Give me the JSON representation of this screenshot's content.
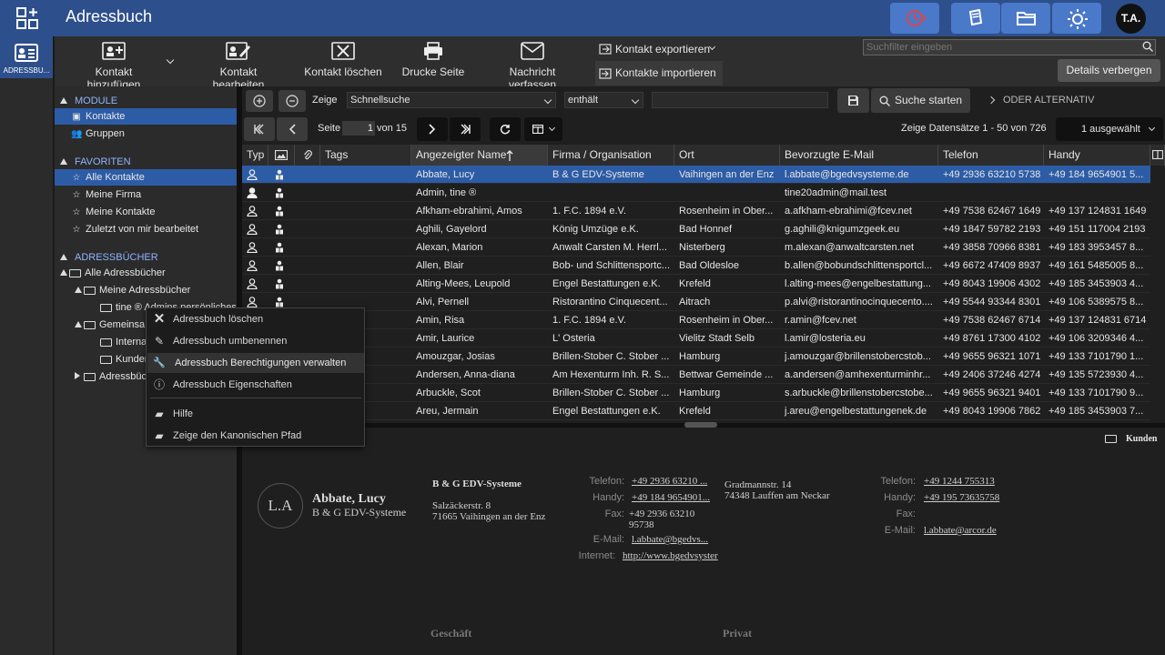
{
  "app": {
    "title": "Adressbuch",
    "rail_label": "ADRESSBU...",
    "avatar": "T.A."
  },
  "toolbar": {
    "add": "Kontakt hinzufügen",
    "edit": "Kontakt bearbeiten",
    "delete": "Kontakt löschen",
    "print": "Drucke Seite",
    "message": "Nachricht verfassen",
    "export": "Kontakt exportieren",
    "import": "Kontakte importieren",
    "search_placeholder": "Suchfilter eingeben",
    "details_btn": "Details verbergen"
  },
  "sidebar": {
    "modules_header": "MODULE",
    "modules": [
      "Kontakte",
      "Gruppen"
    ],
    "favorites_header": "FAVORITEN",
    "favorites": [
      "Alle Kontakte",
      "Meine Firma",
      "Meine Kontakte",
      "Zuletzt von mir bearbeitet"
    ],
    "addressbooks_header": "ADRESSBÜCHER",
    "tree": [
      "Alle Adressbücher",
      "Meine Adressbücher",
      "tine ® Admins persönliches",
      "Gemeinsa",
      "Interna",
      "Kunden",
      "Adressbüc"
    ]
  },
  "filter": {
    "show_label": "Zeige",
    "field": "Schnellsuche",
    "operator": "enthält",
    "search_btn": "Suche starten",
    "or_alt": "ODER ALTERNATIV"
  },
  "paging": {
    "page_label": "Seite",
    "page": "1",
    "of": "von 15",
    "records": "Zeige Datensätze 1 - 50 von 726",
    "selected": "1 ausgewählt"
  },
  "columns": [
    "Typ",
    "Tags",
    "Angezeigter Name",
    "Firma / Organisation",
    "Ort",
    "Bevorzugte E-Mail",
    "Telefon",
    "Handy"
  ],
  "rows": [
    {
      "name": "Abbate, Lucy",
      "org": "B & G EDV-Systeme",
      "city": "Vaihingen an der Enz",
      "email": "l.abbate@bgedvsysteme.de",
      "phone": "+49 2936 63210 5738",
      "mobile": "+49 184 9654901 5..."
    },
    {
      "name": "Admin, tine ®",
      "org": "",
      "city": "",
      "email": "tine20admin@mail.test",
      "phone": "",
      "mobile": ""
    },
    {
      "name": "Afkham-ebrahimi, Amos",
      "org": "1. F.C. 1894 e.V.",
      "city": "Rosenheim in Ober...",
      "email": "a.afkham-ebrahimi@fcev.net",
      "phone": "+49 7538 62467 1649",
      "mobile": "+49 137 124831 1649"
    },
    {
      "name": "Aghili, Gayelord",
      "org": "König Umzüge e.K.",
      "city": "Bad Honnef",
      "email": "g.aghili@knigumzgeek.eu",
      "phone": "+49 1847 59782 2193",
      "mobile": "+49 151 117004 2193"
    },
    {
      "name": "Alexan, Marion",
      "org": "Anwalt Carsten M. Herrl...",
      "city": "Nisterberg",
      "email": "m.alexan@anwaltcarsten.net",
      "phone": "+49 3858 70966 8381",
      "mobile": "+49 183 3953457 8..."
    },
    {
      "name": "Allen, Blair",
      "org": "Bob- und Schlittensportc...",
      "city": "Bad Oldesloe",
      "email": "b.allen@bobundschlittensportcl...",
      "phone": "+49 6672 47409 8937",
      "mobile": "+49 161 5485005 8..."
    },
    {
      "name": "Alting-Mees, Leupold",
      "org": "Engel Bestattungen e.K.",
      "city": "Krefeld",
      "email": "l.alting-mees@engelbestattung...",
      "phone": "+49 8043 19906 4302",
      "mobile": "+49 185 3453903 4..."
    },
    {
      "name": "Alvi, Pernell",
      "org": "Ristorantino Cinquecent...",
      "city": "Aitrach",
      "email": "p.alvi@ristorantinocinquecento....",
      "phone": "+49 5544 93344 8301",
      "mobile": "+49 106 5389575 8..."
    },
    {
      "name": "Amin, Risa",
      "org": "1. F.C. 1894 e.V.",
      "city": "Rosenheim in Ober...",
      "email": "r.amin@fcev.net",
      "phone": "+49 7538 62467 6714",
      "mobile": "+49 137 124831 6714"
    },
    {
      "name": "Amir, Laurice",
      "org": "L' Osteria",
      "city": "Vielitz Stadt Selb",
      "email": "l.amir@losteria.eu",
      "phone": "+49 8761 17300 4102",
      "mobile": "+49 106 3209346 4..."
    },
    {
      "name": "Amouzgar, Josias",
      "org": "Brillen-Stober C. Stober ...",
      "city": "Hamburg",
      "email": "j.amouzgar@brillenstobercstob...",
      "phone": "+49 9655 96321 1071",
      "mobile": "+49 133 7101790 1..."
    },
    {
      "name": "Andersen, Anna-diana",
      "org": "Am Hexenturm Inh. R. S...",
      "city": "Bettwar Gemeinde ...",
      "email": "a.andersen@amhexenturminhr...",
      "phone": "+49 2406 37246 4274",
      "mobile": "+49 135 5723930 4..."
    },
    {
      "name": "Arbuckle, Scot",
      "org": "Brillen-Stober C. Stober ...",
      "city": "Hamburg",
      "email": "s.arbuckle@brillenstobercstobe...",
      "phone": "+49 9655 96321 9401",
      "mobile": "+49 133 7101790 9..."
    },
    {
      "name": "Areu, Jermain",
      "org": "Engel Bestattungen e.K.",
      "city": "Krefeld",
      "email": "j.areu@engelbestattungenek.de",
      "phone": "+49 8043 19906 7862",
      "mobile": "+49 185 3453903 7..."
    }
  ],
  "detail": {
    "container": "Kunden",
    "initials": "L.A",
    "name": "Abbate, Lucy",
    "org": "B & G EDV-Systeme",
    "biz_org": "B & G EDV-Systeme",
    "street": "Salzäckerstr. 8",
    "zip_city": "71665 Vaihingen an der Enz",
    "l_phone": "Telefon:",
    "l_mobile": "Handy:",
    "l_fax": "Fax:",
    "l_email": "E-Mail:",
    "l_web": "Internet:",
    "phone": "+49 2936 63210 ...",
    "mobile": "+49 184 9654901...",
    "fax1": "+49 2936 63210",
    "fax2": "95738",
    "email": "l.abbate@bgedvs...",
    "web": "http://www.bgedvsyster",
    "priv_street": "Gradmannstr. 14",
    "priv_city": "74348 Lauffen am Neckar",
    "priv_phone": "+49 1244 755313",
    "priv_mobile": "+49 195 73635758",
    "priv_email": "l.abbate@arcor.de",
    "biz_header": "Geschäft",
    "priv_header": "Privat"
  },
  "context_menu": [
    "Adressbuch löschen",
    "Adressbuch umbenennen",
    "Adressbuch Berechtigungen verwalten",
    "Adressbuch Eigenschaften",
    "Hilfe",
    "Zeige den Kanonischen Pfad"
  ]
}
